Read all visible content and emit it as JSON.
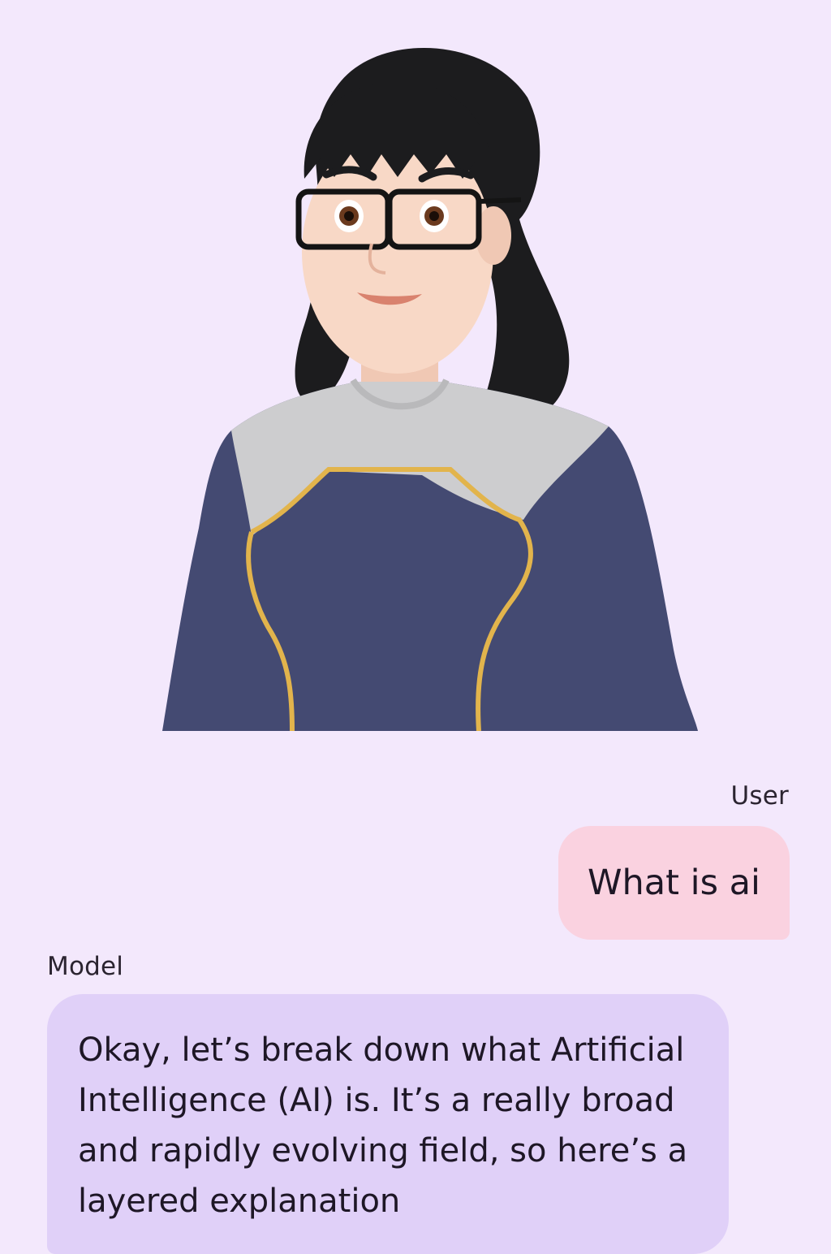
{
  "conversation": {
    "user_label": "User",
    "user_message": "What is ai",
    "model_label": "Model",
    "model_message": "Okay, let’s break down what Artificial Intelligence (AI) is. It’s a really broad and rapidly evolving field, so here’s a layered explanation"
  },
  "avatar": {
    "icon": "avatar-3d-character",
    "colors": {
      "background": "#F3E8FC",
      "hair": "#1C1C1E",
      "skin": "#F8D8C6",
      "shirt_navy": "#444A72",
      "shirt_yoke": "#CDCDCF",
      "trim_gold": "#E2B44C"
    }
  },
  "colors": {
    "user_bubble": "#FAD2E0",
    "model_bubble": "#E0D0F8"
  }
}
